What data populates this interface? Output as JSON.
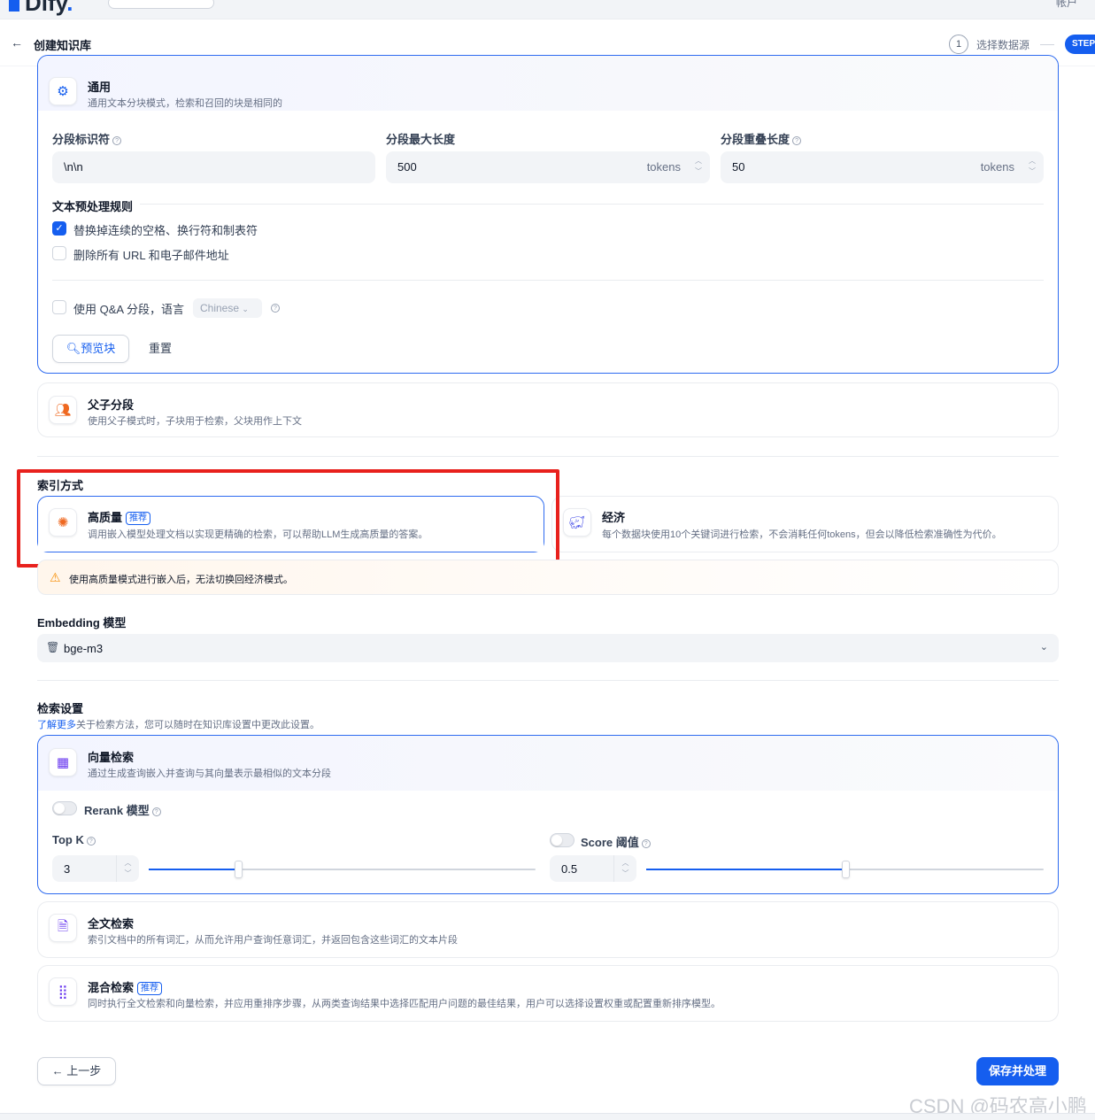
{
  "topbar": {
    "logo_text": "Dify",
    "right_text": "帐户"
  },
  "header": {
    "back_icon": "arrow-left-icon",
    "title": "创建知识库",
    "step1_num": "1",
    "step1_label": "选择数据源",
    "active_step": "STEP"
  },
  "general": {
    "title": "通用",
    "desc": "通用文本分块模式，检索和召回的块是相同的",
    "delimiter_label": "分段标识符",
    "delimiter_value": "\\n\\n",
    "max_len_label": "分段最大长度",
    "max_len_value": "500",
    "max_len_unit": "tokens",
    "overlap_label": "分段重叠长度",
    "overlap_value": "50",
    "overlap_unit": "tokens",
    "preprocess_title": "文本预处理规则",
    "rule1": "替换掉连续的空格、换行符和制表符",
    "rule1_checked": true,
    "rule2": "删除所有 URL 和电子邮件地址",
    "rule2_checked": false,
    "qa_label": "使用 Q&A 分段，语言",
    "qa_lang": "Chinese",
    "preview_button": "预览块",
    "reset_button": "重置"
  },
  "parent_child": {
    "title": "父子分段",
    "desc": "使用父子模式时，子块用于检索，父块用作上下文"
  },
  "index": {
    "section_title": "索引方式",
    "high_quality_title": "高质量",
    "high_quality_badge": "推荐",
    "high_quality_desc": "调用嵌入模型处理文档以实现更精确的检索，可以帮助LLM生成高质量的答案。",
    "economy_title": "经济",
    "economy_desc": "每个数据块使用10个关键词进行检索，不会消耗任何tokens，但会以降低检索准确性为代价。",
    "warning": "使用高质量模式进行嵌入后，无法切换回经济模式。"
  },
  "embedding": {
    "label": "Embedding 模型",
    "model": "bge-m3"
  },
  "retrieval": {
    "section_title": "检索设置",
    "learn_more": "了解更多",
    "learn_more_suffix": "关于检索方法，您可以随时在知识库设置中更改此设置。",
    "vector_title": "向量检索",
    "vector_desc": "通过生成查询嵌入并查询与其向量表示最相似的文本分段",
    "rerank_label": "Rerank 模型",
    "topk_label": "Top K",
    "topk_value": "3",
    "topk_fraction": 0.23,
    "score_label": "Score 阈值",
    "score_value": "0.5",
    "score_fraction": 0.5,
    "fulltext_title": "全文检索",
    "fulltext_desc": "索引文档中的所有词汇，从而允许用户查询任意词汇，并返回包含这些词汇的文本片段",
    "hybrid_title": "混合检索",
    "hybrid_badge": "推荐",
    "hybrid_desc": "同时执行全文检索和向量检索，并应用重排序步骤，从两类查询结果中选择匹配用户问题的最佳结果，用户可以选择设置权重或配置重新排序模型。"
  },
  "footer": {
    "prev_button": "上一步",
    "save_button": "保存并处理"
  },
  "watermark": "CSDN @码农高小鹏",
  "colors": {
    "accent": "#155eef",
    "highlight_box": "#e8211d",
    "warning": "#f79009"
  }
}
